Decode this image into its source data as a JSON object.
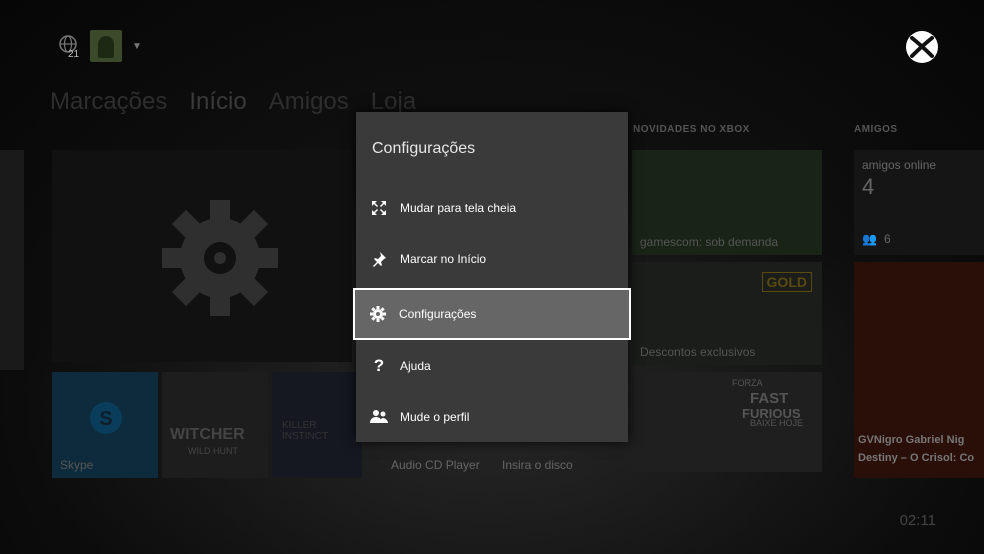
{
  "topbar": {
    "notification_count": "21"
  },
  "nav": {
    "tabs": [
      "Marcações",
      "Início",
      "Amigos",
      "Loja"
    ],
    "active": "Início"
  },
  "sections": {
    "news": "NOVIDADES NO XBOX",
    "friends": "AMIGOS"
  },
  "tiles": {
    "skype": "Skype",
    "witcher_line1": "WITCHER",
    "witcher_line2": "WILD HUNT",
    "killer_instinct": "KILLER INSTINCT",
    "audio_cd": "Audio CD Player",
    "insert_disc": "Insira o disco",
    "gamescom": "gamescom: sob demanda",
    "gold": "GOLD",
    "discounts": "Descontos exclusivos",
    "forza_brand": "FORZA",
    "fast_furious_1": "FAST",
    "fast_furious_2": "FURIOUS",
    "forza_cta": "BAIXE HOJE",
    "friends_online_label": "amigos online",
    "friends_online_count": "4",
    "party_count": "6",
    "destiny_line1": "GVNigro Gabriel Nig",
    "destiny_line2": "Destiny – O Crisol: Co"
  },
  "menu": {
    "title": "Configurações",
    "items": [
      {
        "label": "Mudar para tela cheia",
        "icon": "fullscreen-icon"
      },
      {
        "label": "Marcar no Início",
        "icon": "pin-icon"
      },
      {
        "label": "Configurações",
        "icon": "gear-icon",
        "selected": true
      },
      {
        "label": "Ajuda",
        "icon": "help-icon"
      },
      {
        "label": "Mude o perfil",
        "icon": "switch-profile-icon"
      }
    ]
  },
  "clock": "02:11",
  "colors": {
    "menu_bg": "#3a3a3a",
    "selected_bg": "#666666",
    "skype": "#00aff0",
    "gold": "#f0b400"
  }
}
